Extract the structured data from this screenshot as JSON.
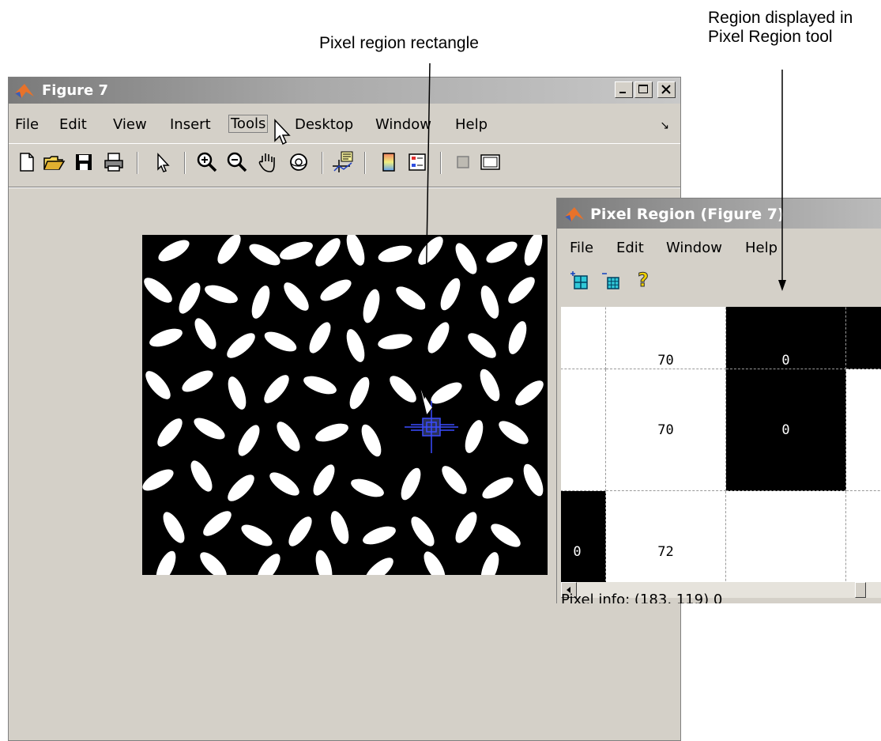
{
  "callouts": {
    "pixel_region_rectangle": "Pixel region rectangle",
    "region_displayed_line1": "Region displayed in",
    "region_displayed_line2": "Pixel Region tool"
  },
  "figure_window": {
    "title": "Figure 7",
    "menu": [
      "File",
      "Edit",
      "View",
      "Insert",
      "Tools",
      "Desktop",
      "Window",
      "Help"
    ],
    "active_menu": "Tools",
    "toolbar_icons": [
      "new-file-icon",
      "open-folder-icon",
      "save-icon",
      "print-icon",
      "pointer-icon",
      "zoom-in-icon",
      "zoom-out-icon",
      "pan-hand-icon",
      "rotate-3d-icon",
      "data-cursor-icon",
      "colorbar-icon",
      "legend-icon",
      "hide-plot-tools-icon",
      "show-plot-tools-icon"
    ]
  },
  "pixel_region_window": {
    "title": "Pixel Region (Figure 7)",
    "menu": [
      "File",
      "Edit",
      "Window",
      "Help"
    ],
    "toolbar_icons": [
      "expand-grid-icon",
      "shrink-grid-icon",
      "help-icon"
    ],
    "grid": {
      "rows": [
        [
          "",
          "70",
          "0",
          ""
        ],
        [
          "",
          "70",
          "0",
          ""
        ],
        [
          "0",
          "72",
          "",
          ""
        ],
        [
          "",
          "",
          "",
          ""
        ]
      ],
      "colors": [
        [
          "white",
          "white",
          "black",
          "black"
        ],
        [
          "white",
          "white",
          "black",
          "white"
        ],
        [
          "black",
          "white",
          "white",
          "white"
        ],
        [
          "black",
          "white",
          "white",
          "white"
        ]
      ]
    },
    "pixel_info": "Pixel info: (183, 119)  0"
  },
  "colors": {
    "window_bg": "#d4d0c8",
    "title_gradient_start": "#7a7a7a",
    "selection_blue": "#3a4cff"
  }
}
